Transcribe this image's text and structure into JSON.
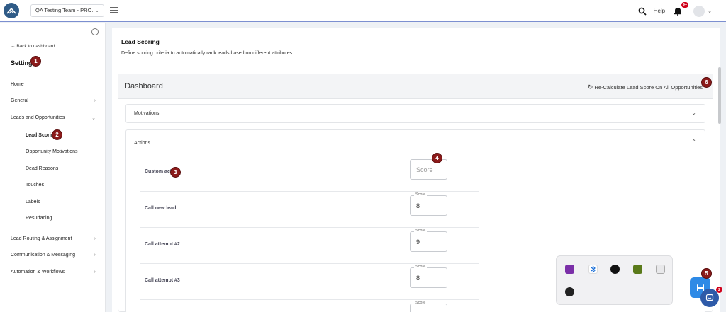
{
  "topbar": {
    "team_select": "QA Testing Team - PRO...",
    "help_label": "Help",
    "notification_badge": "9+"
  },
  "sidebar": {
    "back_label": "Back to dashboard",
    "title": "Settings",
    "items": [
      {
        "label": "Home"
      },
      {
        "label": "General"
      },
      {
        "label": "Leads and Opportunities"
      },
      {
        "label": "Lead Routing & Assignment"
      },
      {
        "label": "Communication & Messaging"
      },
      {
        "label": "Automation & Workflows"
      }
    ],
    "subitems": [
      {
        "label": "Lead Scoring"
      },
      {
        "label": "Opportunity Motivations"
      },
      {
        "label": "Dead Reasons"
      },
      {
        "label": "Touches"
      },
      {
        "label": "Labels"
      },
      {
        "label": "Resurfacing"
      }
    ]
  },
  "header": {
    "title": "Lead Scoring",
    "description": "Define scoring criteria to automatically rank leads based on different attributes."
  },
  "dashboard": {
    "title": "Dashboard",
    "recalc_label": "Re-Calculate Lead Score On All Opportunities",
    "motivations_label": "Motivations",
    "actions_label": "Actions",
    "score_placeholder": "Score",
    "score_legend": "Score",
    "rows": [
      {
        "label": "Custom action",
        "value": ""
      },
      {
        "label": "Call new lead",
        "value": "8"
      },
      {
        "label": "Call attempt #2",
        "value": "9"
      },
      {
        "label": "Call attempt #3",
        "value": "8"
      }
    ]
  },
  "markers": [
    "1",
    "2",
    "3",
    "4",
    "5",
    "6"
  ],
  "chat_badge": "2",
  "colors": {
    "accent": "#2e8ae6",
    "marker": "#8b1a1a",
    "badge": "#d0021b"
  }
}
